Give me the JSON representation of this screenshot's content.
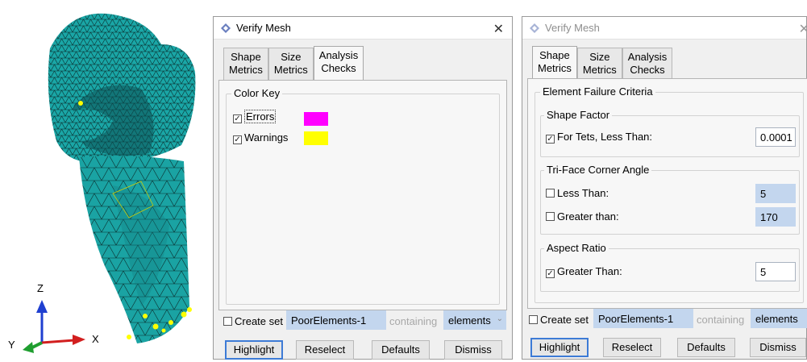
{
  "axes": {
    "z": "Z",
    "x": "X",
    "y": "Y"
  },
  "left_dialog": {
    "title": "Verify Mesh",
    "tabs": [
      {
        "line1": "Shape",
        "line2": "Metrics"
      },
      {
        "line1": "Size",
        "line2": "Metrics"
      },
      {
        "line1": "Analysis",
        "line2": "Checks"
      }
    ],
    "color_key_title": "Color Key",
    "errors_label": "Errors",
    "warnings_label": "Warnings",
    "errors_color": "#ff00ff",
    "warnings_color": "#ffff00",
    "create_set_label": "Create set",
    "set_name": "PoorElements-1",
    "containing_label": "containing",
    "containing_value": "elements",
    "buttons": {
      "highlight": "Highlight",
      "reselect": "Reselect",
      "defaults": "Defaults",
      "dismiss": "Dismiss"
    }
  },
  "right_dialog": {
    "title": "Verify Mesh",
    "tabs": [
      {
        "line1": "Shape",
        "line2": "Metrics"
      },
      {
        "line1": "Size",
        "line2": "Metrics"
      },
      {
        "line1": "Analysis",
        "line2": "Checks"
      }
    ],
    "failure_title": "Element Failure Criteria",
    "shape_factor": {
      "title": "Shape Factor",
      "label": "For Tets, Less Than:",
      "value": "0.0001"
    },
    "tri_face": {
      "title": "Tri-Face Corner Angle",
      "less_label": "Less Than:",
      "less_value": "5",
      "greater_label": "Greater than:",
      "greater_value": "170"
    },
    "aspect_ratio": {
      "title": "Aspect Ratio",
      "label": "Greater Than:",
      "value": "5"
    },
    "create_set_label": "Create set",
    "set_name": "PoorElements-1",
    "containing_label": "containing",
    "containing_value": "elements",
    "buttons": {
      "highlight": "Highlight",
      "reselect": "Reselect",
      "defaults": "Defaults",
      "dismiss": "Dismiss"
    }
  },
  "colors": {
    "mesh": "#1aa3a3",
    "accent": "#3d7bd6",
    "field_highlight": "#c3d6ee"
  }
}
